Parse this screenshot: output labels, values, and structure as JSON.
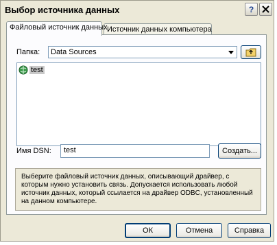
{
  "window": {
    "title": "Выбор источника данных"
  },
  "tabs": [
    {
      "label": "Файловый источник данных",
      "active": true
    },
    {
      "label": "Источник данных компьютера",
      "active": false
    }
  ],
  "folder": {
    "label": "Папка:",
    "value": "Data Sources"
  },
  "list": {
    "items": [
      {
        "name": "test",
        "icon": "dsn-file-icon"
      }
    ]
  },
  "dsn": {
    "label": "Имя DSN:",
    "value": "test",
    "create_label": "Создать..."
  },
  "description": "Выберите файловый источник данных, описывающий драйвер, с которым нужно установить связь.   Допускается использовать любой источник данных, который ссылается на драйвер ODBC, установленный на данном компьютере.",
  "buttons": {
    "ok": "ОК",
    "cancel": "Отмена",
    "help": "Справка"
  }
}
